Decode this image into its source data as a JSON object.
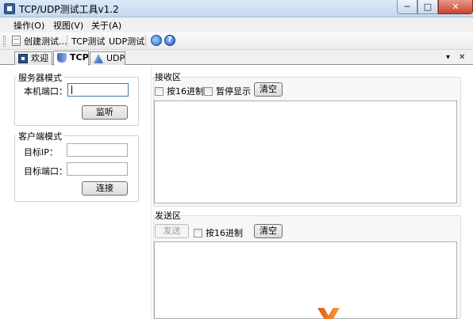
{
  "window": {
    "title": "TCP/UDP测试工具v1.2",
    "buttons": [
      "─",
      "□",
      "✕"
    ]
  },
  "menu": {
    "items": [
      "操作(O)",
      "视图(V)",
      "关于(A)"
    ]
  },
  "toolbar": {
    "create_label": "创建测试...",
    "tcp_label": "TCP测试",
    "udp_label": "UDP测试",
    "help_glyph": "?"
  },
  "tabs": {
    "welcome": "欢迎",
    "tcp": "TCP",
    "udp": "UDP",
    "dropdown_glyph": "▾",
    "close_glyph": "✕"
  },
  "server": {
    "title": "服务器模式",
    "port_label": "本机端口：",
    "port_value": "",
    "listen_label": "监听"
  },
  "client": {
    "title": "客户端模式",
    "ip_label": "目标IP：",
    "ip_value": "",
    "port_label": "目标端口：",
    "port_value": "",
    "connect_label": "连接"
  },
  "receive": {
    "title": "接收区",
    "hex_label": "按16进制",
    "pause_label": "暂停显示",
    "clear_label": "清空",
    "content": ""
  },
  "send": {
    "title": "发送区",
    "send_label": "发送",
    "hex_label": "按16进制",
    "clear_label": "清空",
    "content": ""
  },
  "colors": {
    "watermark_blue": "#3f83d6",
    "watermark_orange": "#e8541e"
  }
}
